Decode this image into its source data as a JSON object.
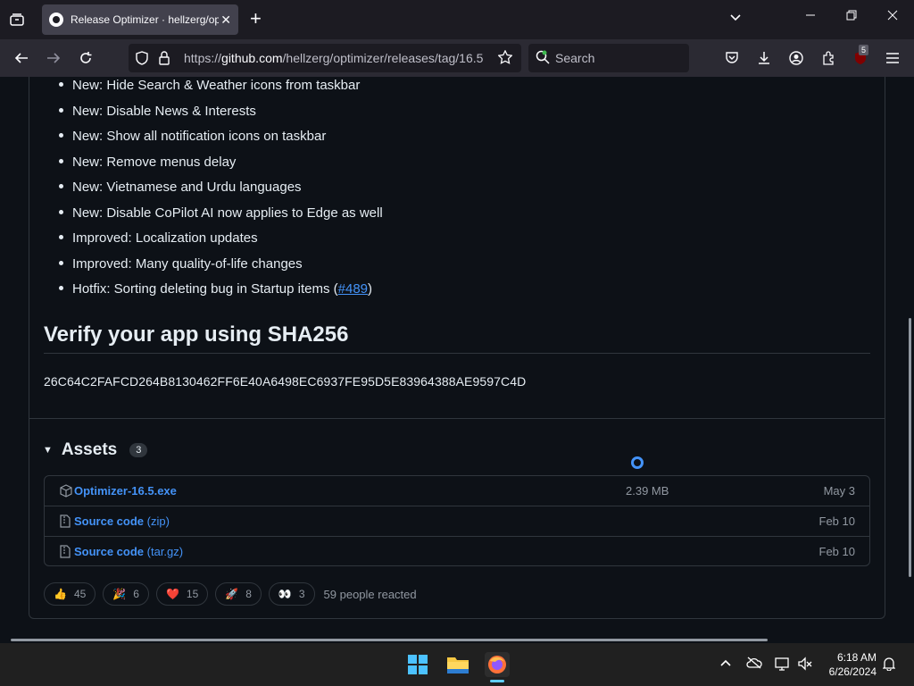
{
  "browser": {
    "tab_title": "Release Optimizer · hellzerg/optimizer",
    "url_domain": "github.com",
    "url_prefix": "https://",
    "url_path": "/hellzerg/optimizer/releases/tag/16.5",
    "search_placeholder": "Search",
    "extension_badge": "5"
  },
  "release_notes": [
    {
      "text": "New: Hide Search & Weather icons from taskbar"
    },
    {
      "text": "New: Disable News & Interests"
    },
    {
      "text": "New: Show all notification icons on taskbar"
    },
    {
      "text": "New: Remove menus delay"
    },
    {
      "text": "New: Vietnamese and Urdu languages"
    },
    {
      "text": "New: Disable CoPilot AI now applies to Edge as well"
    },
    {
      "text": "Improved: Localization updates"
    },
    {
      "text": "Improved: Many quality-of-life changes"
    },
    {
      "text": "Hotfix: Sorting deleting bug in Startup items (",
      "link": "#489",
      "suffix": ")"
    }
  ],
  "verify": {
    "heading": "Verify your app using SHA256",
    "hash": "26C64C2FAFCD264B8130462FF6E40A6498EC6937FE95D5E83964388AE9597C4D"
  },
  "assets": {
    "title": "Assets",
    "count": "3",
    "items": [
      {
        "name": "Optimizer-16.5.exe",
        "ext": "",
        "size": "2.39 MB",
        "date": "May 3"
      },
      {
        "name": "Source code",
        "ext": " (zip)",
        "size": "",
        "date": "Feb 10"
      },
      {
        "name": "Source code",
        "ext": " (tar.gz)",
        "size": "",
        "date": "Feb 10"
      }
    ]
  },
  "reactions": {
    "items": [
      {
        "emoji": "👍",
        "count": "45"
      },
      {
        "emoji": "🎉",
        "count": "6"
      },
      {
        "emoji": "❤️",
        "count": "15"
      },
      {
        "emoji": "🚀",
        "count": "8"
      },
      {
        "emoji": "👀",
        "count": "3"
      }
    ],
    "summary": "59 people reacted"
  },
  "taskbar": {
    "time": "6:18 AM",
    "date": "6/26/2024"
  },
  "colors": {
    "link": "#4493f8",
    "background": "#0d1117",
    "border": "#30363d"
  }
}
